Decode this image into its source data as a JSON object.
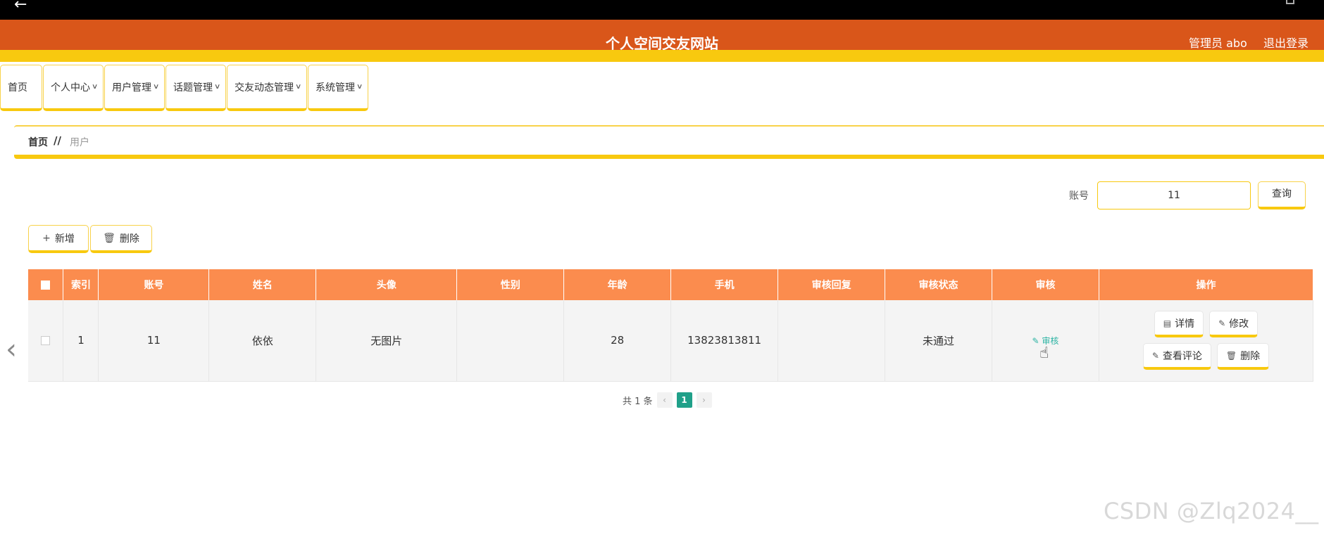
{
  "header": {
    "title": "个人空间交友网站",
    "admin_label": "管理员 abo",
    "logout_label": "退出登录"
  },
  "nav": {
    "items": [
      {
        "label": "首页",
        "dropdown": false
      },
      {
        "label": "个人中心",
        "dropdown": true
      },
      {
        "label": "用户管理",
        "dropdown": true
      },
      {
        "label": "话题管理",
        "dropdown": true
      },
      {
        "label": "交友动态管理",
        "dropdown": true
      },
      {
        "label": "系统管理",
        "dropdown": true
      }
    ]
  },
  "breadcrumb": {
    "home": "首页",
    "separator": "//",
    "current": "用户"
  },
  "search": {
    "label": "账号",
    "value": "11",
    "button_label": "查询"
  },
  "toolbar": {
    "add_label": "新增",
    "delete_label": "删除"
  },
  "table": {
    "columns": [
      "索引",
      "账号",
      "姓名",
      "头像",
      "性别",
      "年龄",
      "手机",
      "审核回复",
      "审核状态",
      "审核",
      "操作"
    ],
    "rows": [
      {
        "index": "1",
        "account": "11",
        "name": "依依",
        "avatar": "无图片",
        "gender": "",
        "age": "28",
        "phone": "13823813811",
        "review_reply": "",
        "review_status": "未通过",
        "review_action": "审核",
        "actions": {
          "detail": "详情",
          "edit": "修改",
          "comments": "查看评论",
          "delete": "删除"
        }
      }
    ]
  },
  "pagination": {
    "total_text": "共 1 条",
    "current_page": "1"
  },
  "watermark": "CSDN @Zlq2024__",
  "colors": {
    "header_bg": "#d9561a",
    "accent_yellow": "#f8c90f",
    "table_header_bg": "#fb8c4e",
    "page_active": "#20a089",
    "link_teal": "#2bb3a3"
  }
}
